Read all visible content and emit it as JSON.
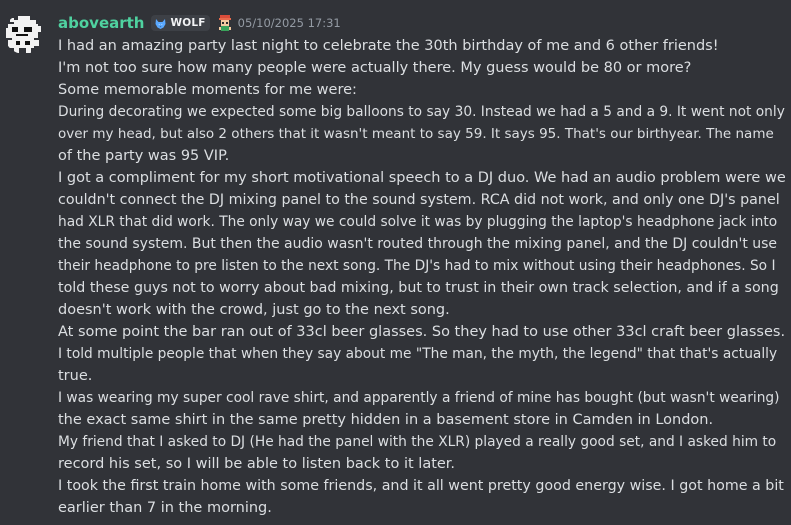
{
  "message": {
    "author": {
      "username": "abovearth",
      "name_color": "#4fd2a0",
      "avatar_icon": "pixel-robot-avatar"
    },
    "tag": {
      "label": "WOLF",
      "icon": "wolf-icon"
    },
    "badge": {
      "icon": "character-badge-icon"
    },
    "timestamp": "05/10/2025 17:31",
    "lines": [
      "I had an amazing party last night to celebrate the 30th birthday of me and 6 other friends!",
      "I'm not too sure how many people were actually there. My guess would be 80 or more?",
      "Some memorable moments for me were:",
      "During decorating we expected some big balloons to say 30. Instead we had a 5 and a 9. It went not only",
      "over my head, but also 2 others that it wasn't meant to say 59. It says 95. That's our birthyear. The name",
      "of the party was 95 VIP.",
      "I got a compliment for my short motivational speech to a DJ duo. We had an audio problem were we",
      "couldn't connect the DJ mixing panel to the sound system. RCA did not work, and only one DJ's panel",
      "had XLR that did work. The only way we could solve it was by plugging the laptop's headphone jack into",
      "the sound system. But then the audio wasn't routed through the mixing panel, and the DJ couldn't use",
      "their headphone to pre listen to the next song. The DJ's had to mix without using their headphones. So I",
      "told these guys not to worry about bad mixing, but to trust in their own track selection, and if a song",
      "doesn't work with the crowd, just go to the next song.",
      "At some point the bar ran out of 33cl beer glasses. So they had to use other 33cl craft beer glasses.",
      "I told multiple people that when they say about me \"The man, the myth, the legend\" that that's actually",
      "true.",
      "I was wearing my super cool rave shirt, and apparently a friend of mine has bought (but wasn't wearing)",
      "the exact same shirt in the same pretty hidden in a basement store in Camden in London.",
      "My friend that I asked to DJ (He had the panel with the XLR) played a really good set, and I asked him to",
      "record his set, so I will be able to listen back to it later.",
      "I took the first train home with some friends, and it all went pretty good energy wise. I got home a bit",
      "earlier than 7 in the morning."
    ]
  }
}
